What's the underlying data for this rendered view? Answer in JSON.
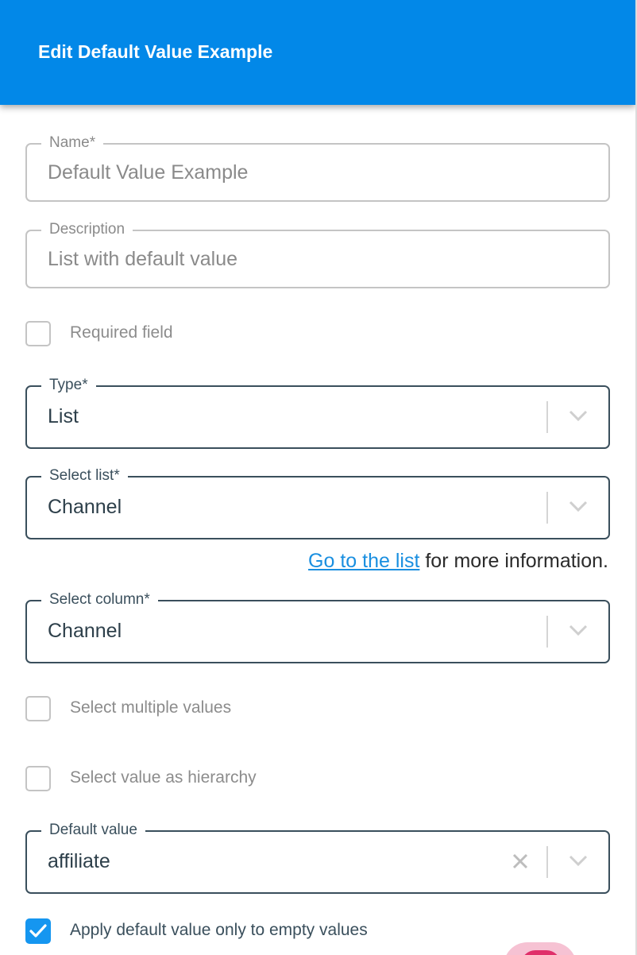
{
  "header": {
    "title": "Edit Default Value Example"
  },
  "name_field": {
    "label": "Name",
    "required_mark": "*",
    "value": "Default Value Example"
  },
  "description_field": {
    "label": "Description",
    "value": "List with default value"
  },
  "required_checkbox": {
    "label": "Required field",
    "checked": false
  },
  "type_field": {
    "label": "Type",
    "required_mark": "*",
    "value": "List"
  },
  "list_field": {
    "label": "Select list",
    "required_mark": "*",
    "value": "Channel"
  },
  "helper": {
    "link_text": "Go to the list",
    "suffix": " for more information."
  },
  "column_field": {
    "label": "Select column",
    "required_mark": "*",
    "value": "Channel"
  },
  "multiple_checkbox": {
    "label": "Select multiple values",
    "checked": false
  },
  "hierarchy_checkbox": {
    "label": "Select value as hierarchy",
    "checked": false
  },
  "default_value_field": {
    "label": "Default value",
    "value": "affiliate"
  },
  "apply_checkbox": {
    "label": "Apply default value only to empty values",
    "checked": true
  },
  "icons": {
    "dropdown": "chevron-down-icon",
    "clear": "close-icon",
    "check": "checkmark-icon"
  },
  "colors": {
    "header": "#0288e8",
    "link": "#1a8fe0",
    "checkbox_checked": "#1596f0",
    "border_active": "#3a4f5c"
  }
}
